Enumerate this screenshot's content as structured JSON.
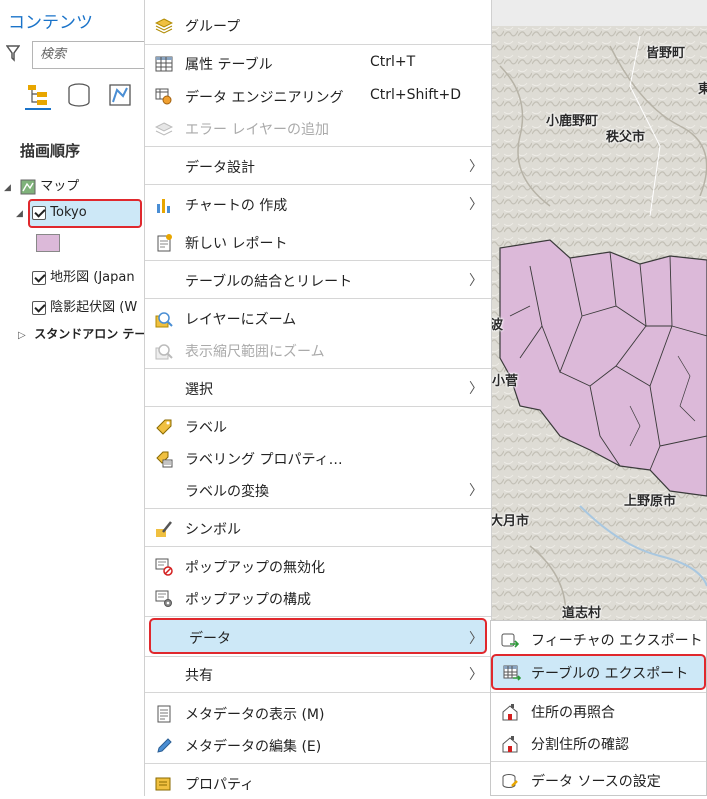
{
  "contents": {
    "title": "コンテンツ",
    "search_placeholder": "検索",
    "draw_order": "描画順序",
    "tree": {
      "map": "マップ",
      "tokyo": "Tokyo",
      "terrain": "地形図 (Japan",
      "hillshade": "陰影起伏図 (W",
      "standalone": "スタンドアロン テーブル"
    },
    "tokyo_symbol_color": "#dcb9d9"
  },
  "menu": {
    "group": "グループ",
    "attribute_table": "属性 テーブル",
    "attribute_table_sc": "Ctrl+T",
    "data_engineering": "データ エンジニアリング",
    "data_engineering_sc": "Ctrl+Shift+D",
    "add_error_layer": "エラー レイヤーの追加",
    "data_design": "データ設計",
    "create_chart": "チャートの 作成",
    "new_report": "新しい レポート",
    "joins_relates": "テーブルの結合とリレート",
    "zoom_to_layer": "レイヤーにズーム",
    "zoom_visible": "表示縮尺範囲にズーム",
    "selection": "選択",
    "label": "ラベル",
    "labeling_props": "ラベリング プロパティ…",
    "convert_labels": "ラベルの変換",
    "symbology": "シンボル",
    "disable_popups": "ポップアップの無効化",
    "configure_popups": "ポップアップの構成",
    "data": "データ",
    "share": "共有",
    "view_metadata": "メタデータの表示 (M)",
    "edit_metadata": "メタデータの編集 (E)",
    "properties": "プロパティ"
  },
  "submenu": {
    "export_features": "フィーチャの エクスポート",
    "export_table": "テーブルの エクスポート",
    "rematch_addresses": "住所の再照合",
    "review_addresses": "分割住所の確認",
    "set_data_source": "データ ソースの設定"
  },
  "map_labels": {
    "minano": "皆野町",
    "higashi": "東",
    "ogano": "小鹿野町",
    "chichibu": "秩父市",
    "nami": "波",
    "kosuge": "小菅",
    "uenohara": "上野原市",
    "otsuki": "大月市",
    "doshi": "道志村"
  },
  "colors": {
    "accent": "#1a73c9",
    "highlight_bg": "#cde8f7",
    "highlight_border": "#e0282d",
    "polygon_fill": "#dcb9d9"
  }
}
